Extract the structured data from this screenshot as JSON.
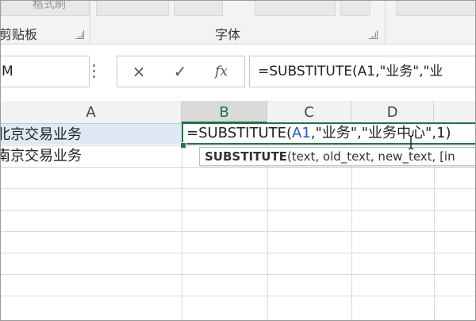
{
  "ribbon": {
    "top_faded_text": "格式刷",
    "clipboard_label": "剪贴板",
    "font_label": "字体",
    "launcher_icon": "dialog-launcher-icon"
  },
  "formula_bar": {
    "name_box_value": "M",
    "cancel_icon": "×",
    "enter_icon": "✓",
    "fx_label": "fx",
    "formula_text": "=SUBSTITUTE(A1,\"业务\",\"业"
  },
  "columns": [
    "A",
    "B",
    "C",
    "D"
  ],
  "cells": {
    "a1": "北京交易业务",
    "a2": "南京交易业务"
  },
  "editing_cell": {
    "prefix": "=SUBSTITUTE(",
    "ref": "A1",
    "suffix": ",\"业务\",\"业务中心\",1)"
  },
  "tooltip": {
    "function_name": "SUBSTITUTE",
    "args": "(text, old_text, new_text, [in"
  },
  "colors": {
    "accent": "#217346",
    "ref": "#1f57c9",
    "selected_fill": "#dfe9f5"
  }
}
